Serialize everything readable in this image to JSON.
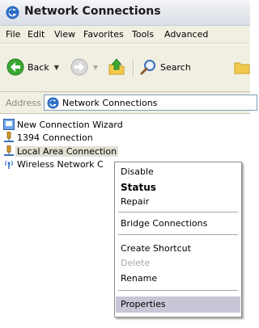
{
  "window": {
    "title": "Network Connections"
  },
  "menubar": {
    "items": [
      "File",
      "Edit",
      "View",
      "Favorites",
      "Tools",
      "Advanced"
    ]
  },
  "toolbar": {
    "back_label": "Back",
    "search_label": "Search"
  },
  "address": {
    "label": "Address",
    "value": "Network Connections"
  },
  "connections": [
    {
      "label": "New Connection Wizard",
      "icon": "wizard-icon"
    },
    {
      "label": "1394 Connection",
      "icon": "network-cable-icon"
    },
    {
      "label": "Local Area Connection",
      "icon": "network-cable-icon",
      "selected": true
    },
    {
      "label": "Wireless Network C",
      "icon": "wireless-icon"
    }
  ],
  "context_menu": {
    "disable": "Disable",
    "status": "Status",
    "repair": "Repair",
    "bridge": "Bridge Connections",
    "create_shortcut": "Create Shortcut",
    "delete": "Delete",
    "rename": "Rename",
    "properties": "Properties"
  },
  "colors": {
    "menu_highlight": "#c7c5d6",
    "toolbar_bg": "#f1efe2",
    "selection": "#e2e0d4"
  }
}
